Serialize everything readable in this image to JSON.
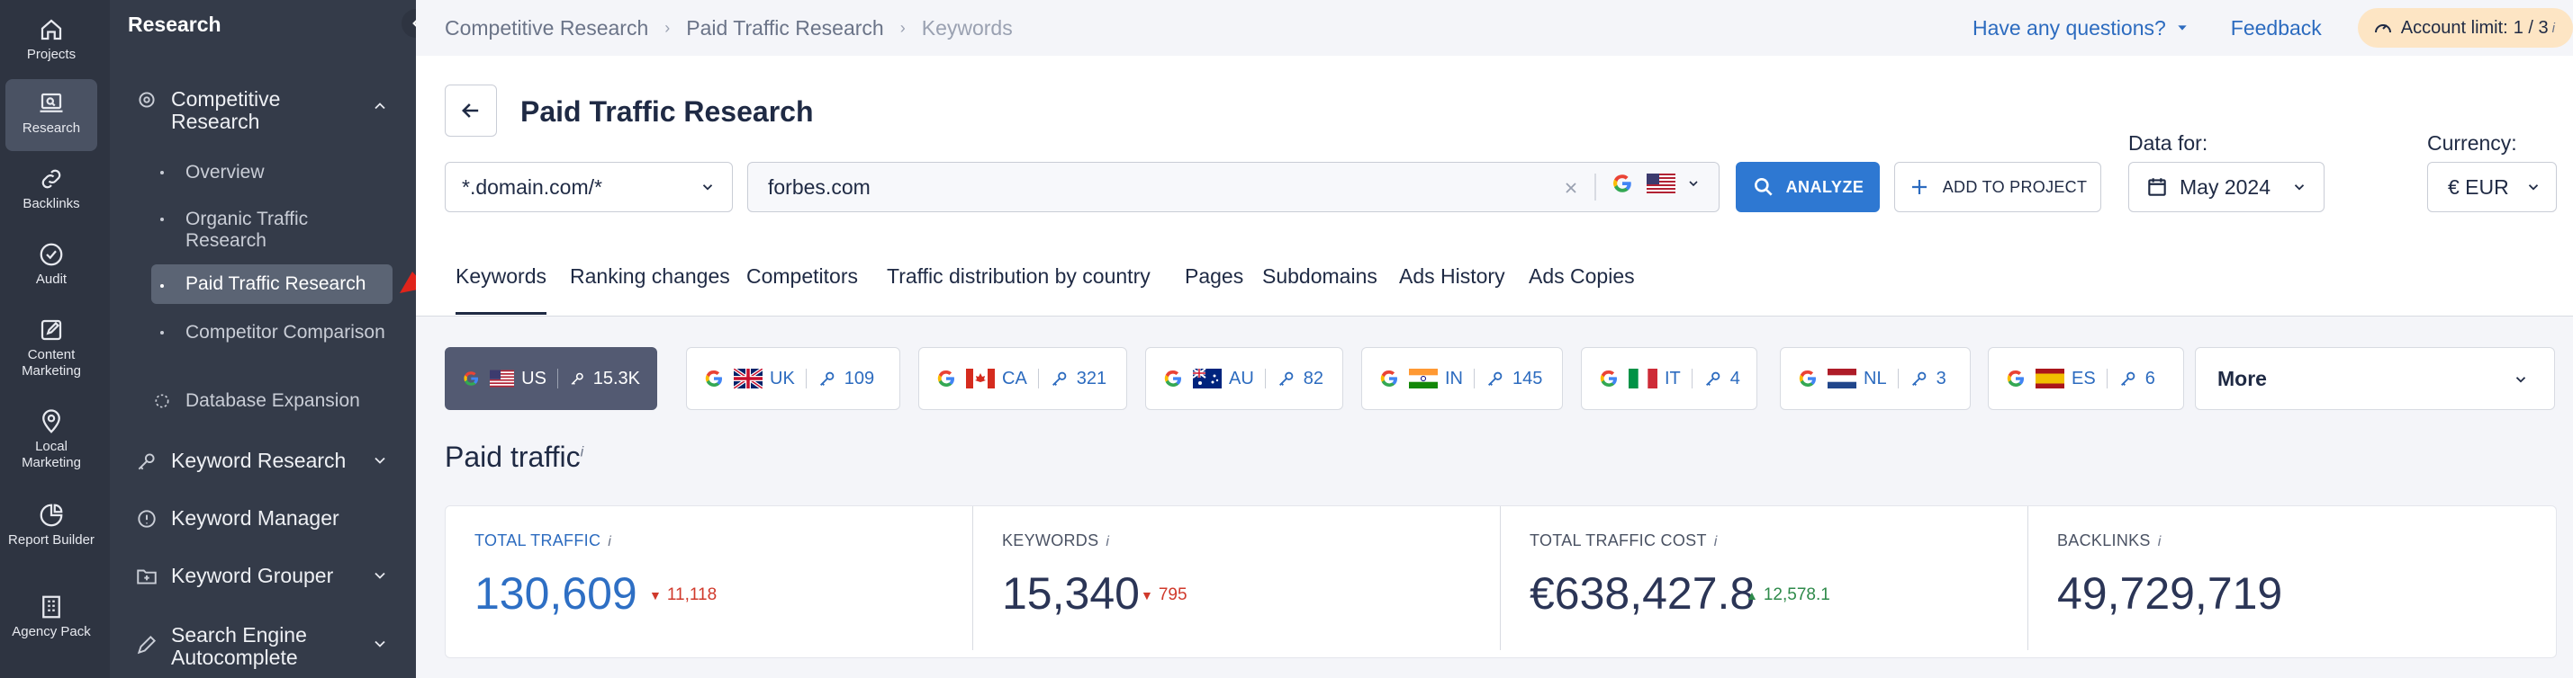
{
  "rail": {
    "items": [
      {
        "label": "Projects",
        "icon": "home-icon"
      },
      {
        "label": "Research",
        "icon": "research-icon",
        "active": true
      },
      {
        "label": "Backlinks",
        "icon": "link-icon"
      },
      {
        "label": "Audit",
        "icon": "check-circle-icon"
      },
      {
        "label": "Content Marketing",
        "icon": "edit-icon"
      },
      {
        "label": "Local Marketing",
        "icon": "pin-icon"
      },
      {
        "label": "Report Builder",
        "icon": "pie-icon"
      },
      {
        "label": "Agency Pack",
        "icon": "building-icon"
      }
    ]
  },
  "sidebar": {
    "title": "Research",
    "competitive": "Competitive Research",
    "subitems": [
      "Overview",
      "Organic Traffic Research",
      "Paid Traffic Research",
      "Competitor Comparison",
      "Database Expansion"
    ],
    "keyword_research": "Keyword Research",
    "keyword_manager": "Keyword Manager",
    "keyword_grouper": "Keyword Grouper",
    "search_engine_autocomplete": "Search Engine Autocomplete"
  },
  "breadcrumb": [
    "Competitive Research",
    "Paid Traffic Research",
    "Keywords"
  ],
  "topbar": {
    "questions": "Have any questions?",
    "feedback": "Feedback",
    "account_label": "Account limit:",
    "account_value": "1 / 3",
    "info": "i"
  },
  "page": {
    "title": "Paid Traffic Research",
    "scope_select": "*.domain.com/*",
    "search_value": "forbes.com",
    "analyze": "ANALYZE",
    "add_to_project": "ADD TO PROJECT",
    "data_for_label": "Data for:",
    "data_for_value": "May 2024",
    "currency_label": "Currency:",
    "currency_value": "€ EUR"
  },
  "tabs": [
    "Keywords",
    "Ranking changes",
    "Competitors",
    "Traffic distribution by country",
    "Pages",
    "Subdomains",
    "Ads History",
    "Ads Copies"
  ],
  "databases": [
    {
      "code": "US",
      "count": "15.3K",
      "flag": "us"
    },
    {
      "code": "UK",
      "count": "109",
      "flag": "uk"
    },
    {
      "code": "CA",
      "count": "321",
      "flag": "ca"
    },
    {
      "code": "AU",
      "count": "82",
      "flag": "au"
    },
    {
      "code": "IN",
      "count": "145",
      "flag": "in"
    },
    {
      "code": "IT",
      "count": "4",
      "flag": "it"
    },
    {
      "code": "NL",
      "count": "3",
      "flag": "nl"
    },
    {
      "code": "ES",
      "count": "6",
      "flag": "es"
    }
  ],
  "more": "More",
  "section_title": "Paid traffic",
  "stats": [
    {
      "label": "TOTAL TRAFFIC",
      "value": "130,609",
      "delta": "11,118",
      "dir": "down"
    },
    {
      "label": "KEYWORDS",
      "value": "15,340",
      "delta": "795",
      "dir": "down"
    },
    {
      "label": "TOTAL TRAFFIC COST",
      "value": "€638,427.8",
      "delta": "12,578.1",
      "dir": "up"
    },
    {
      "label": "BACKLINKS",
      "value": "49,729,719",
      "delta": "",
      "dir": ""
    }
  ],
  "colors": {
    "accent": "#2e78d2",
    "sidebar": "#343b49",
    "rail": "#2e3441",
    "down": "#d0392b",
    "up": "#2e8a4a"
  }
}
